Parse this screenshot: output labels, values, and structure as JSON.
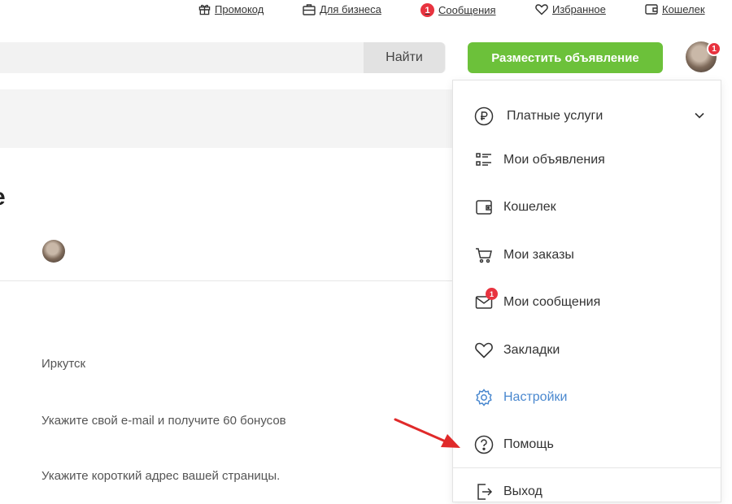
{
  "top_links": [
    {
      "label": "Промокод",
      "icon": "gift-icon"
    },
    {
      "label": "Для бизнеса",
      "icon": "briefcase-icon"
    },
    {
      "label": "Сообщения",
      "icon": "notification-dot",
      "badge": "1"
    },
    {
      "label": "Избранное",
      "icon": "heart-icon"
    },
    {
      "label": "Кошелек",
      "icon": "wallet-icon"
    }
  ],
  "header": {
    "search_button": "Найти",
    "post_button": "Разместить объявление",
    "avatar_badge": "1"
  },
  "page": {
    "city": "Иркутск",
    "email_hint": "Укажите свой e-mail и получите 60 бонусов",
    "address_hint": "Укажите короткий адрес вашей страницы."
  },
  "menu": {
    "items": [
      {
        "label": "Платные услуги",
        "icon": "ruble-circle-icon"
      },
      {
        "label": "Мои объявления",
        "icon": "list-icon"
      },
      {
        "label": "Кошелек",
        "icon": "wallet-icon"
      },
      {
        "label": "Мои заказы",
        "icon": "cart-icon"
      },
      {
        "label": "Мои сообщения",
        "icon": "envelope-icon",
        "badge": "1"
      },
      {
        "label": "Закладки",
        "icon": "heart-icon"
      },
      {
        "label": "Настройки",
        "icon": "gear-icon"
      },
      {
        "label": "Помощь",
        "icon": "help-circle-icon"
      },
      {
        "label": "Выход",
        "icon": "logout-icon"
      }
    ]
  },
  "colors": {
    "accent_green": "#6cc13a",
    "badge_red": "#e8333f",
    "settings_blue": "#4a88cf"
  }
}
